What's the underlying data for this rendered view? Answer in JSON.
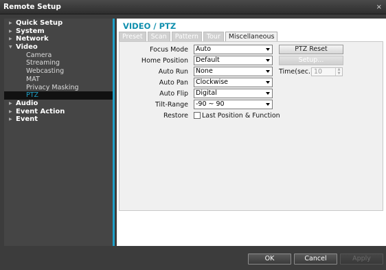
{
  "window": {
    "title": "Remote Setup",
    "close": "×"
  },
  "nav": [
    {
      "type": "group",
      "label": "Quick Setup",
      "expanded": false
    },
    {
      "type": "group",
      "label": "System",
      "expanded": false
    },
    {
      "type": "group",
      "label": "Network",
      "expanded": false
    },
    {
      "type": "group",
      "label": "Video",
      "expanded": true
    },
    {
      "type": "sub",
      "label": "Camera"
    },
    {
      "type": "sub",
      "label": "Streaming"
    },
    {
      "type": "sub",
      "label": "Webcasting"
    },
    {
      "type": "sub",
      "label": "MAT"
    },
    {
      "type": "sub",
      "label": "Privacy Masking"
    },
    {
      "type": "sub",
      "label": "PTZ",
      "active": true
    },
    {
      "type": "group",
      "label": "Audio",
      "expanded": false
    },
    {
      "type": "group",
      "label": "Event Action",
      "expanded": false
    },
    {
      "type": "group",
      "label": "Event",
      "expanded": false
    }
  ],
  "page": {
    "title": "VIDEO / PTZ",
    "tabs": [
      "Preset",
      "Scan",
      "Pattern",
      "Tour",
      "Miscellaneous"
    ],
    "active_tab": "Miscellaneous"
  },
  "form": {
    "focus_mode": {
      "label": "Focus Mode",
      "value": "Auto"
    },
    "home_position": {
      "label": "Home Position",
      "value": "Default"
    },
    "auto_run": {
      "label": "Auto Run",
      "value": "None"
    },
    "auto_pan": {
      "label": "Auto Pan",
      "value": "Clockwise"
    },
    "auto_flip": {
      "label": "Auto Flip",
      "value": "Digital"
    },
    "tilt_range": {
      "label": "Tilt-Range",
      "value": "-90 ~ 90"
    },
    "restore": {
      "label": "Restore",
      "checkbox_label": "Last Position & Function",
      "checked": false
    },
    "ptz_reset": "PTZ Reset",
    "setup": "Setup...",
    "time_label": "Time(sec.)",
    "time_value": "10"
  },
  "footer": {
    "ok": "OK",
    "cancel": "Cancel",
    "apply": "Apply"
  },
  "colors": {
    "accent": "#1ea0c8",
    "title": "#0f8fae"
  }
}
